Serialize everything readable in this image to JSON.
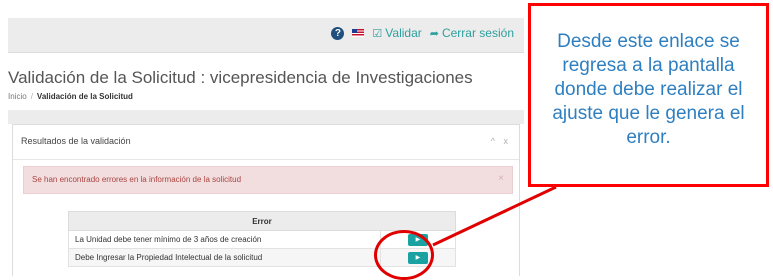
{
  "topbar": {
    "validate_label": "Validar",
    "logout_label": "Cerrar sesión",
    "icons": {
      "help": "help-icon",
      "flag": "us-flag-icon",
      "validate": "check-square-icon",
      "logout": "sign-out-icon"
    }
  },
  "page": {
    "title": "Validación de la Solicitud : vicepresidencia de Investigaciones",
    "breadcrumb": {
      "home": "Inicio",
      "separator": "/",
      "current": "Validación de la Solicitud"
    }
  },
  "panel": {
    "title": "Resultados de la validación",
    "tools": "^ x",
    "alert": {
      "text": "Se han encontrado errores en la información de la solicitud",
      "close": "×"
    }
  },
  "table": {
    "header": "Error",
    "rows": [
      {
        "message": "La Unidad debe tener mínimo de 3 años de creación",
        "action": "▶"
      },
      {
        "message": "Debe Ingresar la Propiedad Intelectual de la solicitud",
        "action": "▶"
      }
    ]
  },
  "callout": {
    "text": "Desde este enlace se regresa a la pantalla donde debe realizar el ajuste que le genera el error.",
    "border_color": "#ff0000",
    "text_color": "#2f7fc0"
  },
  "colors": {
    "accent": "#1aa1a1",
    "alert_bg": "#f2dede",
    "alert_text": "#a94442"
  }
}
